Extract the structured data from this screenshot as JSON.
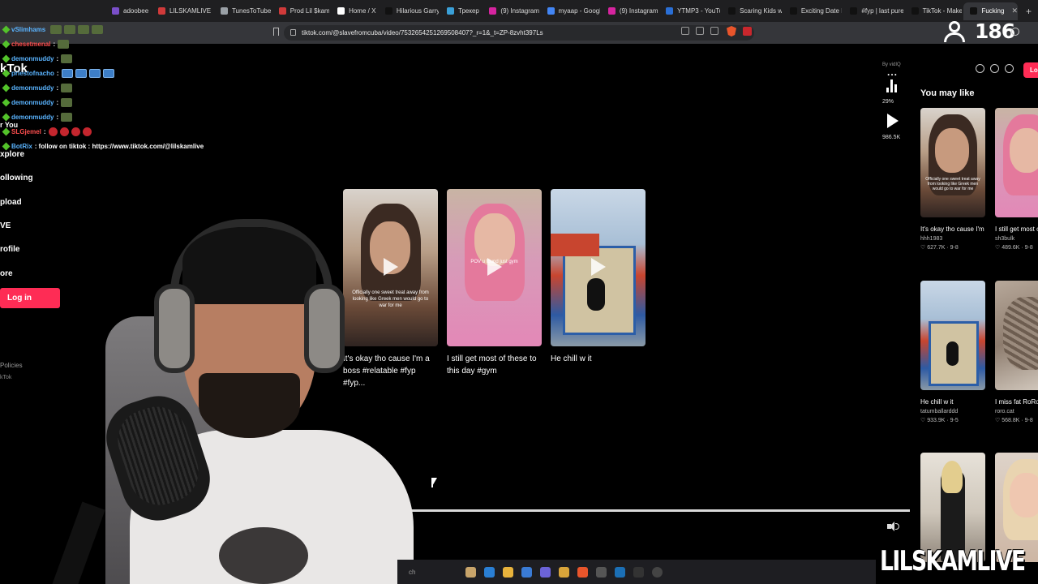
{
  "browser": {
    "tabs": [
      {
        "label": "adoobee",
        "color": "#7a4fc9"
      },
      {
        "label": "LILSKAMLIVE C",
        "color": "#d03a3a"
      },
      {
        "label": "TunesToTube",
        "color": "#9aa0a6"
      },
      {
        "label": "Prod Lil $kam",
        "color": "#d03a3a"
      },
      {
        "label": "Home / X",
        "color": "#ffffff"
      },
      {
        "label": "Hilarious Garry",
        "color": "#111111"
      },
      {
        "label": "Трекер",
        "color": "#3aa0d8"
      },
      {
        "label": "(9) Instagram",
        "color": "#d6249f"
      },
      {
        "label": "myaap - Googl",
        "color": "#4285f4"
      },
      {
        "label": "(9) Instagram",
        "color": "#d6249f"
      },
      {
        "label": "YTMP3 - YouTu",
        "color": "#2a6fd6"
      },
      {
        "label": "Scaring Kids w",
        "color": "#111111"
      },
      {
        "label": "Exciting Date I",
        "color": "#111111"
      },
      {
        "label": "#fyp | last pure",
        "color": "#111111"
      },
      {
        "label": "TikTok - Make",
        "color": "#111111"
      },
      {
        "label": "Fucking",
        "color": "#111111",
        "active": true
      }
    ],
    "new_tab": "+",
    "url": "tiktok.com/@slavefromcuba/video/7532654251269508407?_r=1&_t=ZP-8zvht397Ls"
  },
  "stream": {
    "viewer_count": "186",
    "watermark": "LILSKAMLIVE",
    "chat": [
      {
        "user": "vSlimhams",
        "msg": "",
        "emotes": [
          "gray",
          "gray",
          "gray",
          "gray"
        ],
        "red": false
      },
      {
        "user": "chesetmenal",
        "msg": ":",
        "emotes": [
          "gray"
        ],
        "red": true
      },
      {
        "user": "demonmuddy",
        "msg": ":",
        "emotes": [
          "gray"
        ],
        "red": false
      },
      {
        "user": "priestofnacho",
        "msg": ":",
        "emotes": [
          "blue",
          "blue",
          "blue",
          "blue"
        ],
        "red": false
      },
      {
        "user": "demonmuddy",
        "msg": ":",
        "emotes": [
          "gray"
        ],
        "red": false
      },
      {
        "user": "demonmuddy",
        "msg": ":",
        "emotes": [
          "gray"
        ],
        "red": false
      },
      {
        "user": "demonmuddy",
        "msg": ":",
        "emotes": [
          "gray"
        ],
        "red": false
      },
      {
        "user": "SLGjemel",
        "msg": ":",
        "emotes": [
          "red",
          "red",
          "red",
          "red"
        ],
        "red": true
      },
      {
        "user": "BotRix",
        "msg": ": follow on tiktok : https://www.tiktok.com/@lilskamlive",
        "emotes": [],
        "red": false
      }
    ]
  },
  "tiktok": {
    "logo_text": "kTok",
    "nav": [
      "xplore",
      "ollowing",
      "pload",
      "VE",
      "rofile",
      "ore"
    ],
    "you_label": "r You",
    "login_label": "Log in",
    "login_top": "Lo",
    "policies": "Policies",
    "tiktok_small": "kTok",
    "side": {
      "by_vidiq": "By vidIQ",
      "more": "...",
      "percent": "29%",
      "views": "986.5K"
    },
    "related": [
      {
        "title": "It's okay tho cause I'm a boss #relatable #fyp #fyp...",
        "caption": "Officially one sweet treat away from looking like Greek men would go to war for me",
        "style": "th1"
      },
      {
        "title": "I still get most of these to this day #gym",
        "caption": "POV u found just gym",
        "style": "th2"
      },
      {
        "title": "He chill w it",
        "caption": "",
        "style": "th3"
      }
    ],
    "you_may_like": "You may like",
    "suggested": [
      {
        "title": "It's okay tho cause I'm a boss #relatab...",
        "author": "hhh1983",
        "meta": "627.7K · 9-8",
        "style": "girl"
      },
      {
        "title": "I still get most of these to this d...",
        "author": "sh3bulk",
        "meta": "489.6K · 9-8",
        "style": "pink"
      },
      {
        "title": "He chill w it",
        "author": "tatumballarddd",
        "meta": "933.9K · 9-5",
        "style": "sign"
      },
      {
        "title": "I miss fat RoRo #catsoftiktok...",
        "author": "roro.cat",
        "meta": "568.8K · 9-8",
        "style": "cat"
      },
      {
        "title": "",
        "author": "",
        "meta": "",
        "style": "blond"
      },
      {
        "title": "",
        "author": "",
        "meta": "",
        "style": "girl2"
      }
    ]
  },
  "taskbar": {
    "search_text": "ch"
  }
}
